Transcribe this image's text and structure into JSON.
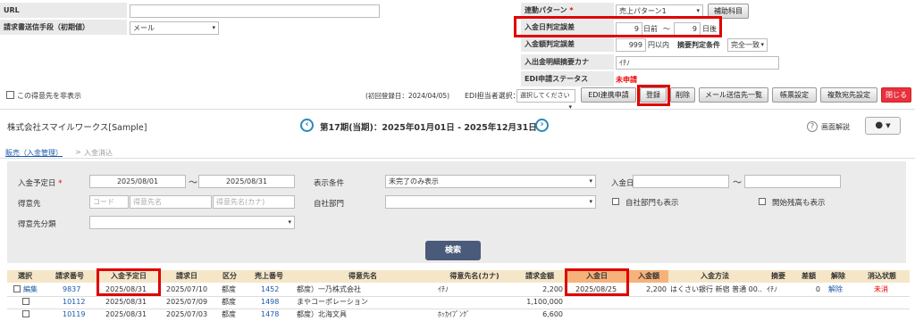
{
  "top": {
    "url_label": "URL",
    "send_label": "請求書送信手段（初期値）",
    "send_value": "メール",
    "link_label": "連動パターン",
    "link_value": "売上パターン1",
    "aux_button": "補助科目",
    "date_err_label": "入金日判定誤差",
    "date_before": "9",
    "before_text": "日前",
    "tilde": "～",
    "date_after": "9",
    "after_text": "日後",
    "amt_err_label": "入金額判定誤差",
    "amt_value": "999",
    "amt_unit": "円以内",
    "summary_cond_label": "摘要判定条件",
    "summary_cond_value": "完全一致",
    "kana_label": "入出金明細摘要カナ",
    "kana_value": "ｲﾁﾉ",
    "edi_status_label": "EDI申請ステータス",
    "edi_status_value": "未申請",
    "hide_checkbox_label": "この得意先を非表示",
    "first_reg": "(初回登録日：2024/04/05)",
    "edi_person_label": "EDI担当者選択：",
    "edi_person_placeholder": "選択してください",
    "buttons": [
      "EDI連携申請",
      "登録",
      "削除",
      "メール送信先一覧",
      "帳票設定",
      "複数宛先設定",
      "閉じる"
    ],
    "required_mark": "*"
  },
  "header": {
    "company": "株式会社スマイルワークス[Sample]",
    "period": "第17期(当期)：2025年01月01日 - 2025年12月31日",
    "help": "画面解説"
  },
  "breadcrumb": {
    "parent": "販売（入金管理）",
    "sep": ">",
    "current": "入金消込"
  },
  "search": {
    "due_label": "入金予定日",
    "due_from": "2025/08/01",
    "due_to": "2025/08/31",
    "tilde": "～",
    "display_label": "表示条件",
    "display_value": "未完了のみ表示",
    "paydate_label": "入金日",
    "customer_label": "得意先",
    "code_ph": "コード",
    "name_ph": "得意先名",
    "kana_ph": "得意先名(カナ)",
    "dept_label": "自社部門",
    "dept_show": "自社部門も表示",
    "start_bal": "開始残高も表示",
    "cat_label": "得意先分類",
    "search_button": "検索"
  },
  "table": {
    "headers": [
      "選択",
      "請求番号",
      "入金予定日",
      "請求日",
      "区分",
      "売上番号",
      "得意先名",
      "得意先名(カナ)",
      "請求金額",
      "入金日",
      "入金額",
      "入金方法",
      "摘要",
      "差額",
      "解除",
      "消込状態"
    ],
    "rows": [
      {
        "edit": "編集",
        "no": "9837",
        "due": "2025/08/31",
        "inv": "2025/07/10",
        "kbn": "都度",
        "sale": "1452",
        "name": "都度）一乃株式会社",
        "kana": "ｲﾁﾉ",
        "amount": "2,200",
        "paydate": "2025/08/25",
        "payamt": "2,200",
        "method": "はくさい銀行 新宿 普通 00...",
        "memo": "ｲﾁﾉ",
        "diff": "0",
        "cancel": "解除",
        "status": "未消"
      },
      {
        "edit": "",
        "no": "10112",
        "due": "2025/08/31",
        "inv": "2025/07/09",
        "kbn": "都度",
        "sale": "1498",
        "name": "まやコーポレーション",
        "kana": "",
        "amount": "1,100,000",
        "paydate": "",
        "payamt": "",
        "method": "",
        "memo": "",
        "diff": "",
        "cancel": "",
        "status": ""
      },
      {
        "edit": "",
        "no": "10119",
        "due": "2025/08/31",
        "inv": "2025/07/03",
        "kbn": "都度",
        "sale": "1478",
        "name": "都度）北海文具",
        "kana": "ﾎｯｶｲﾌﾞﾝｸﾞ",
        "amount": "6,600",
        "paydate": "",
        "payamt": "",
        "method": "",
        "memo": "",
        "diff": "",
        "cancel": "",
        "status": ""
      }
    ]
  },
  "colors": {
    "accent": "#4a5a7a",
    "required": "#e00000",
    "link": "#1a5aa8"
  }
}
